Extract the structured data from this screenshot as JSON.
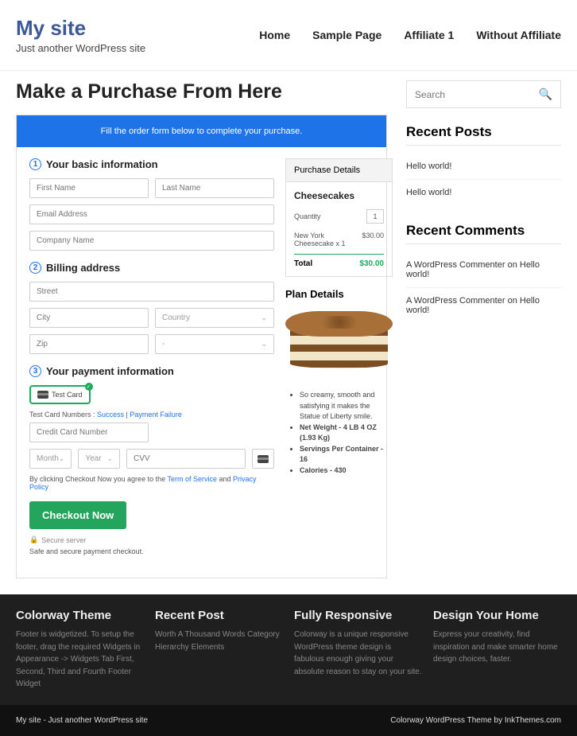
{
  "site": {
    "title": "My site",
    "tagline": "Just another WordPress site"
  },
  "nav": [
    "Home",
    "Sample Page",
    "Affiliate 1",
    "Without Affiliate"
  ],
  "page_title": "Make a Purchase From Here",
  "banner": "Fill the order form below to complete your purchase.",
  "step1": {
    "title": "Your basic information",
    "first_name": "First Name",
    "last_name": "Last Name",
    "email": "Email Address",
    "company": "Company Name"
  },
  "step2": {
    "title": "Billing address",
    "street": "Street",
    "city": "City",
    "country": "Country",
    "zip": "Zip",
    "dash": "-"
  },
  "step3": {
    "title": "Your payment information",
    "card_label": "Test  Card",
    "test_prefix": "Test Card Numbers : ",
    "success": "Success",
    "failure": "Payment Failure",
    "sep": " | ",
    "cc": "Credit Card Number",
    "month": "Month",
    "year": "Year",
    "cvv": "CVV",
    "terms_prefix": "By clicking Checkout Now you agree to the ",
    "tos": "Term of Service",
    "and": " and ",
    "privacy": "Privacy Policy"
  },
  "checkout_btn": "Checkout Now",
  "secure": "Secure server",
  "safe": "Safe and secure payment checkout.",
  "details": {
    "head": "Purchase Details",
    "product": "Cheesecakes",
    "qty_label": "Quantity",
    "qty": "1",
    "line_name": "New York Cheesecake x 1",
    "line_price": "$30.00",
    "total_label": "Total",
    "total": "$30.00"
  },
  "plan": {
    "title": "Plan Details",
    "bullets": [
      "So creamy, smooth and satisfying it makes the Statue of Liberty smile.",
      "Net Weight - 4 LB 4 OZ (1.93 Kg)",
      "Servings Per Container - 16",
      "Calories - 430"
    ]
  },
  "sidebar": {
    "search": "Search",
    "recent_posts": {
      "head": "Recent Posts",
      "items": [
        "Hello world!",
        "Hello world!"
      ]
    },
    "recent_comments": {
      "head": "Recent Comments",
      "items": [
        {
          "author": "A WordPress Commenter",
          "on": " on ",
          "post": "Hello world!"
        },
        {
          "author": "A WordPress Commenter",
          "on": " on ",
          "post": "Hello world!"
        }
      ]
    }
  },
  "footer": {
    "cols": [
      {
        "title": "Colorway Theme",
        "text": "Footer is widgetized. To setup the footer, drag the required Widgets in Appearance -> Widgets Tab First, Second, Third and Fourth Footer Widget"
      },
      {
        "title": "Recent Post",
        "text": "Worth A Thousand Words Category Hierarchy Elements"
      },
      {
        "title": "Fully Responsive",
        "text": "Colorway is a unique responsive WordPress theme design is fabulous enough giving your absolute reason to stay on your site."
      },
      {
        "title": "Design Your Home",
        "text": "Express your creativity, find inspiration and make smarter home design choices, faster."
      }
    ],
    "bar_left": "My site - Just another WordPress site",
    "bar_right": "Colorway WordPress Theme by InkThemes.com"
  }
}
